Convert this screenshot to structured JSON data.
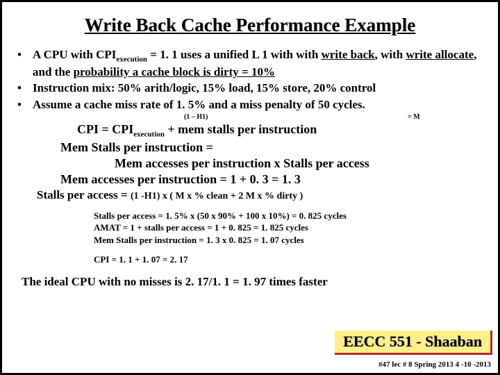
{
  "title": "Write Back Cache Performance Example",
  "bullets": [
    {
      "prefix": "A CPU with  CPI",
      "sub": "execution",
      "mid": " =  1. 1 uses a unified L 1 with with ",
      "u1": "write back",
      "mid2": ", with ",
      "u2": "write allocate",
      "mid3": ", and the ",
      "u3": "probability a cache block is dirty =  10%"
    },
    {
      "text": "Instruction mix:   50% arith/logic,  15% load, 15% store, 20% control"
    },
    {
      "text": "Assume a cache miss rate of 1. 5% and a miss penalty of 50 cycles."
    }
  ],
  "annot": {
    "left": "(1 – H1)",
    "right": "= M"
  },
  "equations": {
    "e1a": "CPI =   CPI",
    "e1b": "execution",
    "e1c": "  +   mem stalls per instruction",
    "e2": "Mem Stalls per instruction =",
    "e3": "Mem accesses per instruction  x  Stalls per access",
    "e4": "Mem accesses per instruction =  1  +    0. 3    =   1. 3",
    "e5a": "Stalls per access =   ",
    "e5b": "(1 -H1)  x  ( M x   % clean   +  2 M x   % dirty )"
  },
  "calc": [
    "Stalls per access  = 1. 5%  x  (50  x  90% +   100 x 10%)  =  0. 825  cycles",
    "AMAT  =  1  +  stalls per access =   1 +  0. 825 =  1. 825  cycles",
    "Mem Stalls per instruction  =   1. 3  x   0. 825  =   1. 07 cycles"
  ],
  "cpicalc": "CPI =  1. 1  + 1. 07 =   2. 17",
  "ideal": "The ideal CPU with no misses is  2. 17/1. 1 =  1. 97   times faster",
  "badge": "EECC 551 - Shaaban",
  "footnote": "#47   lec # 8    Spring 2013  4 -10 -2013",
  "chart_data": {
    "type": "table",
    "title": "Write Back Cache Performance Example",
    "parameters": {
      "CPI_execution": 1.1,
      "cache_levels": "unified L1",
      "policy": "write back, write allocate",
      "P_dirty": 0.1,
      "mix_arith_logic": 0.5,
      "mix_load": 0.15,
      "mix_store": 0.15,
      "mix_control": 0.2,
      "miss_rate": 0.015,
      "miss_penalty_cycles": 50
    },
    "derived": {
      "mem_accesses_per_instruction": 1.3,
      "stalls_per_access": 0.825,
      "AMAT_cycles": 1.825,
      "mem_stalls_per_instruction": 1.07,
      "CPI": 2.17,
      "speedup_vs_ideal": 1.97
    }
  }
}
